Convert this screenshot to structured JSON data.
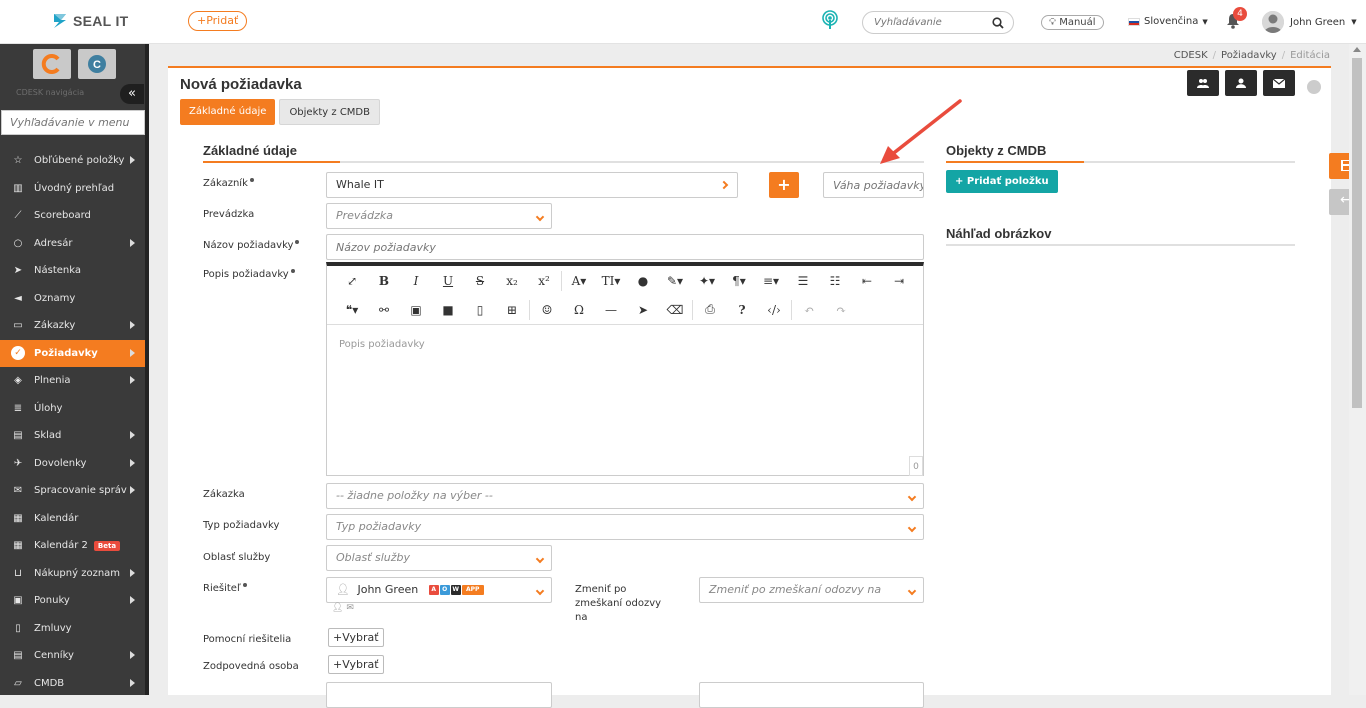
{
  "header": {
    "logo_text": "SEAL IT",
    "add_label": "+Pridať",
    "search_placeholder": "Vyhľadávanie",
    "manual_label": "Manuál",
    "language": "Slovenčina",
    "notification_count": "4",
    "user_name": "John Green"
  },
  "sidebar": {
    "nav_label": "CDESK navigácia",
    "search_placeholder": "Vyhľadávanie v menu",
    "items": [
      {
        "label": "Obľúbené položky",
        "icon": "star-icon",
        "arrow": true
      },
      {
        "label": "Úvodný prehľad",
        "icon": "bar-chart-icon",
        "arrow": false
      },
      {
        "label": "Scoreboard",
        "icon": "line-chart-icon",
        "arrow": false
      },
      {
        "label": "Adresár",
        "icon": "user-icon",
        "arrow": true
      },
      {
        "label": "Nástenka",
        "icon": "send-icon",
        "arrow": false
      },
      {
        "label": "Oznamy",
        "icon": "megaphone-icon",
        "arrow": false
      },
      {
        "label": "Zákazky",
        "icon": "credit-card-icon",
        "arrow": true
      },
      {
        "label": "Požiadavky",
        "icon": "check-circle-icon",
        "arrow": true,
        "active": true
      },
      {
        "label": "Plnenia",
        "icon": "cube-icon",
        "arrow": true
      },
      {
        "label": "Úlohy",
        "icon": "list-icon",
        "arrow": false
      },
      {
        "label": "Sklad",
        "icon": "box-icon",
        "arrow": true
      },
      {
        "label": "Dovolenky",
        "icon": "plane-icon",
        "arrow": true
      },
      {
        "label": "Spracovanie správ",
        "icon": "mail-icon",
        "arrow": true
      },
      {
        "label": "Kalendár",
        "icon": "calendar-icon",
        "arrow": false
      },
      {
        "label": "Kalendár 2",
        "icon": "calendar-icon",
        "arrow": false,
        "badge": "Beta"
      },
      {
        "label": "Nákupný zoznam",
        "icon": "cart-icon",
        "arrow": true
      },
      {
        "label": "Ponuky",
        "icon": "gift-icon",
        "arrow": true
      },
      {
        "label": "Zmluvy",
        "icon": "file-icon",
        "arrow": false
      },
      {
        "label": "Cenníky",
        "icon": "book-icon",
        "arrow": true
      },
      {
        "label": "CMDB",
        "icon": "folder-icon",
        "arrow": true
      }
    ]
  },
  "breadcrumb": [
    "CDESK",
    "Požiadavky",
    "Editácia"
  ],
  "main": {
    "title": "Nová požiadavka",
    "tabs": [
      "Základné údaje",
      "Objekty z CMDB"
    ],
    "section_basic": "Základné údaje",
    "section_cmdb": "Objekty z CMDB",
    "section_preview": "Náhľad obrázkov",
    "add_item_label": "+ Pridať položku",
    "labels": {
      "customer": "Zákazník",
      "facility": "Prevádzka",
      "request_name": "Názov požiadavky",
      "description": "Popis požiadavky",
      "order": "Zákazka",
      "request_type": "Typ požiadavky",
      "service_area": "Oblasť služby",
      "resolver": "Riešiteľ",
      "change_on_missed": "Zmeniť po zmeškaní odozvy na",
      "helper_resolvers": "Pomocní riešitelia",
      "responsible": "Zodpovedná osoba"
    },
    "values": {
      "customer": "Whale IT",
      "weight_placeholder": "Váha požiadavky",
      "facility_placeholder": "Prevádzka",
      "request_name_placeholder": "Názov požiadavky",
      "description_placeholder": "Popis požiadavky",
      "editor_count": "0",
      "order": "-- žiadne položky na výber --",
      "request_type_placeholder": "Typ požiadavky",
      "service_area_placeholder": "Oblasť služby",
      "resolver": "John Green",
      "change_placeholder": "Zmeniť po zmeškaní odozvy na",
      "select_label": "+Vybrať"
    },
    "resolver_chips": [
      "A",
      "O",
      "W",
      "APP"
    ],
    "chip_colors": [
      "#e94c3d",
      "#3b9ad9",
      "#2b2b2b",
      "#f47c20"
    ]
  },
  "colors": {
    "accent": "#f47c20",
    "teal": "#14a5a5",
    "sidebar_bg": "#3a3a3a"
  }
}
